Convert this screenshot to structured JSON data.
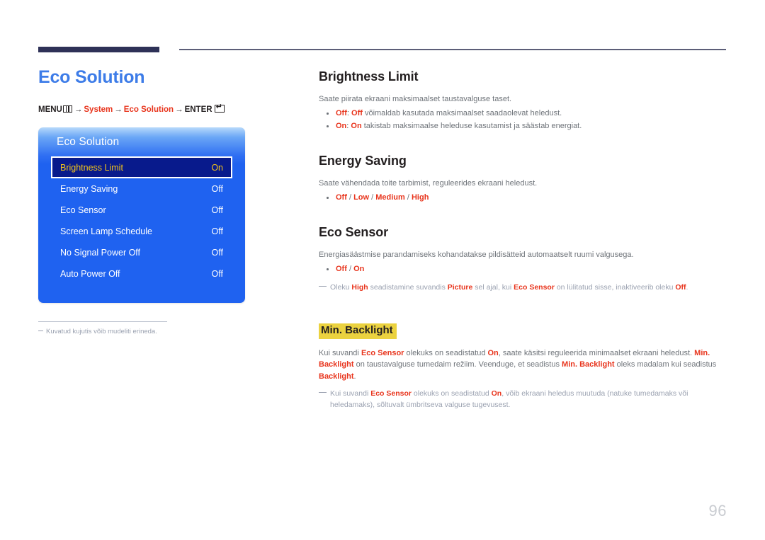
{
  "page": {
    "number": "96",
    "title": "Eco Solution"
  },
  "breadcrumb": {
    "menu_label": "MENU",
    "menu_icon": "menu-grid-icon",
    "arrow": "→",
    "step1": "System",
    "step2": "Eco Solution",
    "enter_label": "ENTER",
    "enter_icon": "enter-key-icon"
  },
  "osd": {
    "title": "Eco Solution",
    "rows": [
      {
        "label": "Brightness Limit",
        "value": "On",
        "selected": true
      },
      {
        "label": "Energy Saving",
        "value": "Off",
        "selected": false
      },
      {
        "label": "Eco Sensor",
        "value": "Off",
        "selected": false
      },
      {
        "label": "Screen Lamp Schedule",
        "value": "Off",
        "selected": false
      },
      {
        "label": "No Signal Power Off",
        "value": "Off",
        "selected": false
      },
      {
        "label": "Auto Power Off",
        "value": "Off",
        "selected": false
      }
    ]
  },
  "left_note": {
    "text": "Kuvatud kujutis võib mudeliti erineda."
  },
  "sections": {
    "brightness_limit": {
      "heading": "Brightness Limit",
      "intro": "Saate piirata ekraani maksimaalset taustavalguse taset.",
      "bullet_off_key": "Off",
      "bullet_off_sep": ": ",
      "bullet_off_term": "Off",
      "bullet_off_rest": " võimaldab kasutada maksimaalset saadaolevat heledust.",
      "bullet_on_key": "On",
      "bullet_on_sep": ": ",
      "bullet_on_term": "On",
      "bullet_on_rest": " takistab maksimaalse heleduse kasutamist ja säästab energiat."
    },
    "energy_saving": {
      "heading": "Energy Saving",
      "intro": "Saate vähendada toite tarbimist, reguleerides ekraani heledust.",
      "opt_off": "Off",
      "opt_low": "Low",
      "opt_medium": "Medium",
      "opt_high": "High",
      "opt_sep": " / "
    },
    "eco_sensor": {
      "heading": "Eco Sensor",
      "intro": "Energiasäästmise parandamiseks kohandatakse pildisätteid automaatselt ruumi valgusega.",
      "opt_off": "Off",
      "opt_on": "On",
      "opt_sep": " / ",
      "note_a": "Oleku ",
      "note_high": "High",
      "note_b": " seadistamine suvandis ",
      "note_picture": "Picture",
      "note_c": " sel ajal, kui ",
      "note_ecosensor": "Eco Sensor",
      "note_d": " on lülitatud sisse, inaktiveerib oleku ",
      "note_off": "Off",
      "note_e": "."
    },
    "min_backlight": {
      "heading": "Min. Backlight",
      "p_a": "Kui suvandi ",
      "p_ecosensor": "Eco Sensor",
      "p_b": " olekuks on seadistatud ",
      "p_on": "On",
      "p_c": ", saate käsitsi reguleerida minimaalset ekraani heledust. ",
      "p_minbacklight": "Min. Backlight",
      "p_d": " on taustavalguse tumedaim režiim. Veenduge, et seadistus ",
      "p_minbacklight2": "Min. Backlight",
      "p_e": " oleks madalam kui seadistus ",
      "p_backlight": "Backlight",
      "p_f": ".",
      "note_a": "Kui suvandi ",
      "note_ecosensor": "Eco Sensor",
      "note_b": " olekuks on seadistatud ",
      "note_on": "On",
      "note_c": ", võib ekraani heledus muutuda (natuke tumedamaks või heledamaks), sõltuvalt ümbritseva valguse tugevusest."
    }
  },
  "colors": {
    "accent_blue": "#3d7ce8",
    "accent_red": "#e8341c",
    "osd_blue": "#1f62f0",
    "osd_selected": "#081a8c",
    "osd_selected_text": "#f5c518",
    "highlight_yellow": "#ebd23f",
    "rule_navy": "#2e3157"
  }
}
